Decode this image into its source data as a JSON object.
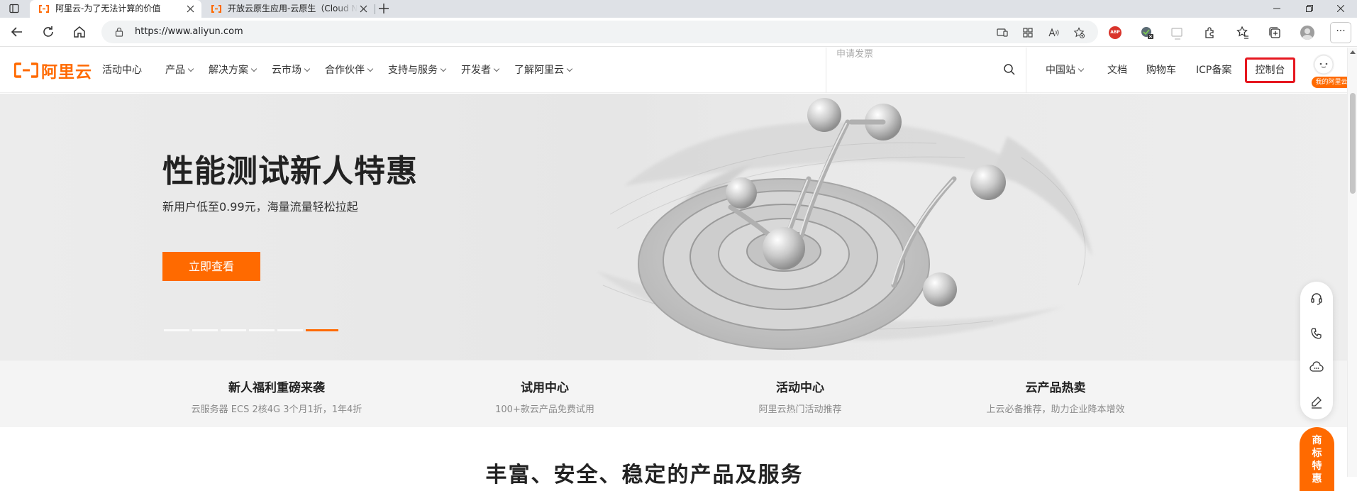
{
  "browser": {
    "tabs": [
      {
        "title": "阿里云-为了无法计算的价值",
        "active": true,
        "favicon": "aliyun-favicon"
      },
      {
        "title": "开放云原生应用-云原生（Cloud Native）",
        "active": false,
        "favicon": "aliyun-favicon"
      }
    ],
    "new_tab_icon": "plus-icon",
    "window_controls": [
      "minimize-icon",
      "restore-icon",
      "close-icon"
    ],
    "address_bar": {
      "url": "https://www.aliyun.com",
      "lock_icon": "lock-icon"
    },
    "toolbar_icons": [
      "read-mode-icon",
      "apps-icon",
      "read-aloud-icon",
      "add-favorite-icon",
      "adblock-plus-icon",
      "extension-badge-icon",
      "screenshot-icon",
      "extensions-icon",
      "favorites-icon",
      "collections-icon",
      "profile-icon",
      "more-icon"
    ],
    "adblock_label": "ABP",
    "more_label": "···"
  },
  "site_header": {
    "logo_text": "阿里云",
    "nav": [
      {
        "label": "活动中心",
        "has_dropdown": false
      },
      {
        "label": "产品",
        "has_dropdown": true
      },
      {
        "label": "解决方案",
        "has_dropdown": true
      },
      {
        "label": "云市场",
        "has_dropdown": true
      },
      {
        "label": "合作伙伴",
        "has_dropdown": true
      },
      {
        "label": "支持与服务",
        "has_dropdown": true
      },
      {
        "label": "开发者",
        "has_dropdown": true
      },
      {
        "label": "了解阿里云",
        "has_dropdown": true
      }
    ],
    "search_placeholder": "申请发票",
    "right_links": [
      "中国站",
      "文档",
      "购物车",
      "ICP备案"
    ],
    "console_label": "控制台",
    "my_aliyun_label": "我的阿里云"
  },
  "hero": {
    "title": "性能测试新人特惠",
    "subtitle": "新用户低至0.99元，海量流量轻松拉起",
    "cta_label": "立即查看",
    "carousel_slides": 6,
    "carousel_active_index": 5
  },
  "highlights": [
    {
      "title": "新人福利重磅来袭",
      "desc": "云服务器 ECS 2核4G 3个月1折，1年4折"
    },
    {
      "title": "试用中心",
      "desc": "100+款云产品免费试用"
    },
    {
      "title": "活动中心",
      "desc": "阿里云热门活动推荐"
    },
    {
      "title": "云产品热卖",
      "desc": "上云必备推荐，助力企业降本增效"
    }
  ],
  "section_title": "丰富、安全、稳定的产品及服务",
  "floating_tools": [
    "headset-icon",
    "phone-icon",
    "cloud-chat-icon",
    "edit-icon"
  ],
  "promo_badge": [
    "商",
    "标",
    "特",
    "惠"
  ],
  "colors": {
    "brand": "#ff6a00",
    "highlight_border": "#e6171f"
  }
}
